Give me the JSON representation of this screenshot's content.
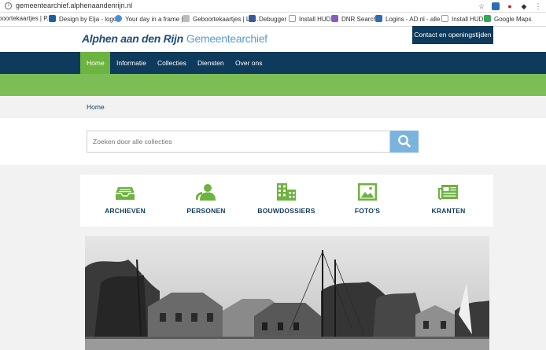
{
  "browser": {
    "url": "gemeentearchief.alphenaandenrijn.nl",
    "bookmarks": [
      {
        "label": "boortekaartjes | P...",
        "color": "#2a6db8"
      },
      {
        "label": "Design by Elja - logo",
        "color": "#1a5fa8"
      },
      {
        "label": "Your day in a frame |",
        "color": "#4a90d9"
      },
      {
        "label": "Geboortekaartjes | Le...",
        "color": "#d8d8d8"
      },
      {
        "label": "Debugger",
        "color": "#3b5998"
      },
      {
        "label": "Install HUD",
        "color": "#e8e8e8"
      },
      {
        "label": "DNR Search",
        "color": "#8a5ac4"
      },
      {
        "label": "Logins - AD.nl - alle ...",
        "color": "#2a6db8"
      },
      {
        "label": "Install HUD",
        "color": "#e8e8e8"
      },
      {
        "label": "Google Maps",
        "color": "#34a853"
      }
    ]
  },
  "header": {
    "logo_main": "Alphen aan den Rijn",
    "logo_sub": "Gemeentearchief",
    "contact_label": "Contact en openingstijden"
  },
  "nav": {
    "items": [
      {
        "label": "Home"
      },
      {
        "label": "Informatie"
      },
      {
        "label": "Collecties"
      },
      {
        "label": "Diensten"
      },
      {
        "label": "Over ons"
      }
    ]
  },
  "breadcrumb": {
    "current": "Home"
  },
  "search": {
    "placeholder": "Zoeken door alle collecties"
  },
  "categories": [
    {
      "label": "ARCHIEVEN",
      "icon": "inbox-icon"
    },
    {
      "label": "PERSONEN",
      "icon": "person-icon"
    },
    {
      "label": "BOUWDOSSIERS",
      "icon": "building-icon"
    },
    {
      "label": "FOTO'S",
      "icon": "photo-icon"
    },
    {
      "label": "KRANTEN",
      "icon": "newspaper-icon"
    }
  ],
  "colors": {
    "navy": "#0e3a5b",
    "green": "#7cbd56",
    "active": "#6db33f",
    "icon_green": "#6db33f",
    "search_button": "#7ab4de"
  }
}
